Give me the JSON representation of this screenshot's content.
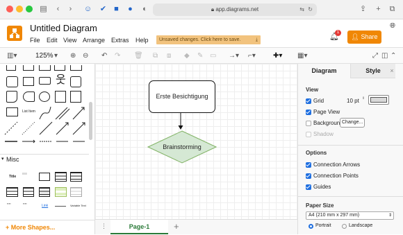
{
  "browser": {
    "url": "app.diagrams.net"
  },
  "app": {
    "title": "Untitled Diagram",
    "menu": [
      "File",
      "Edit",
      "View",
      "Arrange",
      "Extras",
      "Help"
    ],
    "unsaved_notice": "Unsaved changes. Click here to save.",
    "share_label": "Share",
    "notification_count": "1"
  },
  "toolbar": {
    "zoom": "125%"
  },
  "left_panel": {
    "list_item_label": "List Item",
    "misc_header": "Misc",
    "misc_title_label": "Title",
    "misc_link_label": "Link",
    "misc_variable_label": "Variable Text",
    "more_shapes": "More Shapes..."
  },
  "canvas": {
    "shape1_text": "Erste Besichtigung",
    "shape2_text": "Brainstorming",
    "page_tab": "Page-1"
  },
  "format_panel": {
    "tab_diagram": "Diagram",
    "tab_style": "Style",
    "view_header": "View",
    "grid_label": "Grid",
    "grid_size": "10 pt",
    "grid_color": "#d9d9d9",
    "page_view_label": "Page View",
    "background_label": "Background",
    "change_button": "Change...",
    "shadow_label": "Shadow",
    "options_header": "Options",
    "connection_arrows": "Connection Arrows",
    "connection_points": "Connection Points",
    "guides": "Guides",
    "paper_size_header": "Paper Size",
    "paper_size_value": "A4 (210 mm x 297 mm)",
    "portrait_label": "Portrait",
    "landscape_label": "Landscape"
  },
  "colors": {
    "accent_orange": "#f08705",
    "diamond_fill": "#d5e8d4",
    "diamond_stroke": "#82b366",
    "checkbox_blue": "#1f6fe0"
  }
}
